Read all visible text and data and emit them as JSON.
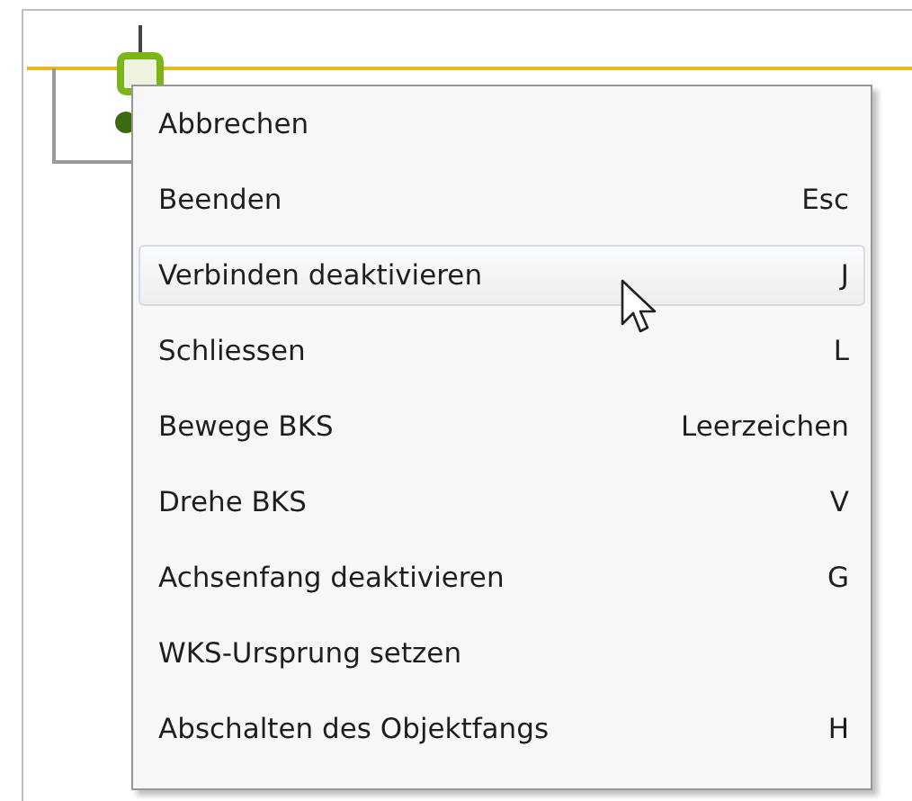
{
  "context_menu": {
    "items": [
      {
        "label": "Abbrechen",
        "selected": false
      },
      {
        "label": "Beenden",
        "shortcut": "Esc",
        "selected": false
      },
      {
        "label": "Verbinden deaktivieren",
        "shortcut": "J",
        "selected": true
      },
      {
        "label": "Schliessen",
        "shortcut": "L",
        "selected": false
      },
      {
        "label": "Bewege BKS",
        "shortcut": "Leerzeichen",
        "selected": false
      },
      {
        "label": "Drehe BKS",
        "shortcut": "V",
        "selected": false
      },
      {
        "label": "Achsenfang deaktivieren",
        "shortcut": "G",
        "selected": false
      },
      {
        "label": "WKS-Ursprung setzen",
        "selected": false
      },
      {
        "label": "Abschalten des Objektfangs",
        "shortcut": "H",
        "selected": false
      }
    ]
  }
}
